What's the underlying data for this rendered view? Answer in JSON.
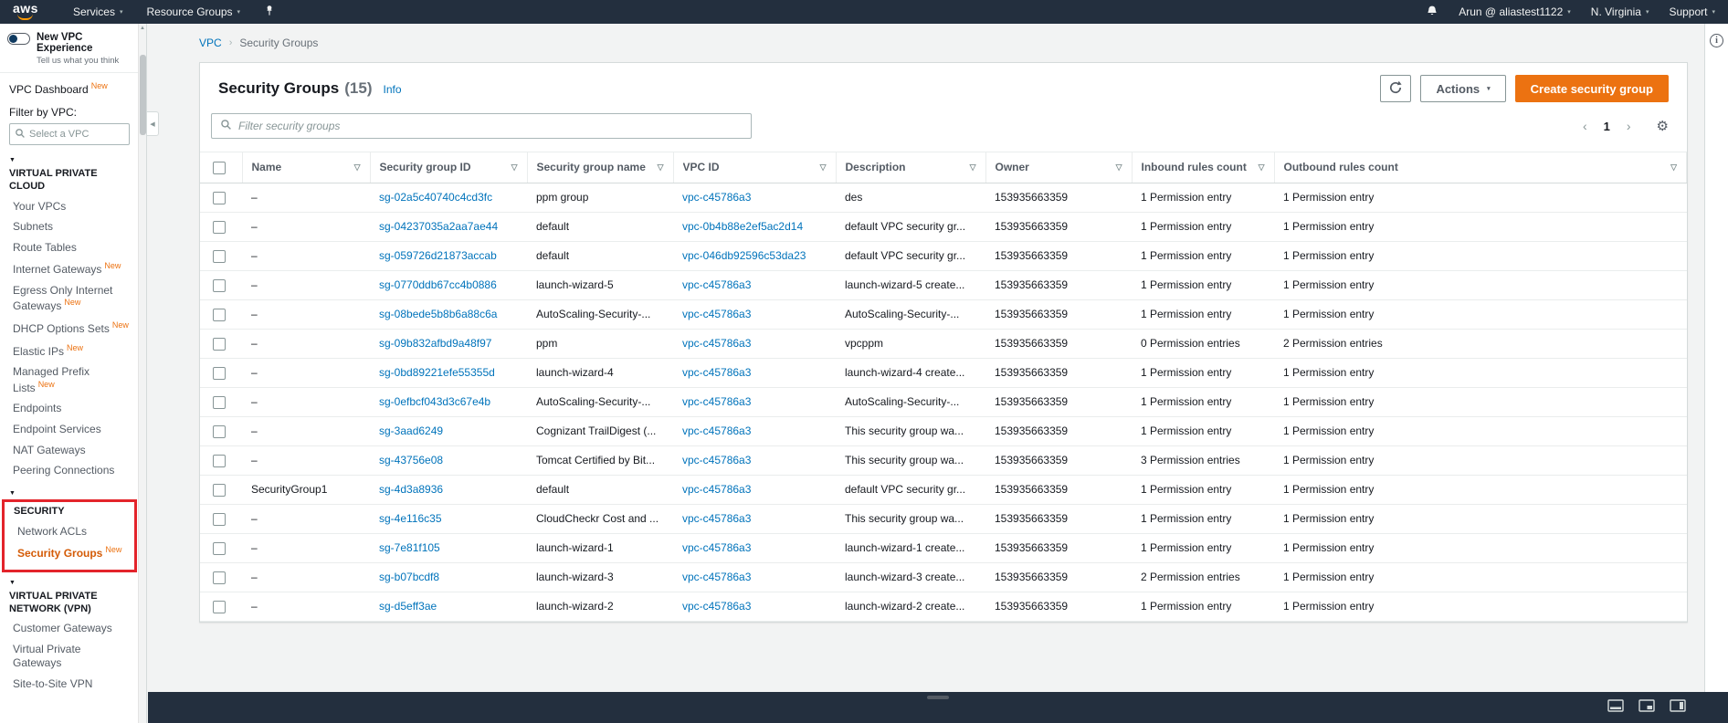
{
  "colors": {
    "topnav_bg": "#232f3e",
    "accent_orange": "#ec7211",
    "link_blue": "#0073bb",
    "highlight_red": "#e3242b",
    "selected_nav": "#d45b07"
  },
  "icons": {
    "caret_down": "▾",
    "section_triangle": "▼",
    "column_filter": "▽",
    "chevron_left": "‹",
    "chevron_right": "›",
    "gear": "⚙",
    "collapse_left": "◀",
    "info": "i"
  },
  "topnav": {
    "logo_text": "aws",
    "services_label": "Services",
    "resource_groups_label": "Resource Groups",
    "user_label": "Arun @ aliastest1122",
    "region_label": "N. Virginia",
    "support_label": "Support"
  },
  "sidebar": {
    "experience": {
      "title": "New VPC Experience",
      "subtitle": "Tell us what you think"
    },
    "dashboard": {
      "label": "VPC Dashboard",
      "badge": "New"
    },
    "filter_label": "Filter by VPC:",
    "filter_placeholder": "Select a VPC",
    "sections": [
      {
        "title": "VIRTUAL PRIVATE CLOUD",
        "items": [
          {
            "label": "Your VPCs"
          },
          {
            "label": "Subnets"
          },
          {
            "label": "Route Tables"
          },
          {
            "label": "Internet Gateways",
            "badge": "New"
          },
          {
            "label": "Egress Only Internet Gateways",
            "badge": "New"
          },
          {
            "label": "DHCP Options Sets",
            "badge": "New"
          },
          {
            "label": "Elastic IPs",
            "badge": "New"
          },
          {
            "label": "Managed Prefix Lists",
            "badge": "New"
          },
          {
            "label": "Endpoints"
          },
          {
            "label": "Endpoint Services"
          },
          {
            "label": "NAT Gateways"
          },
          {
            "label": "Peering Connections"
          }
        ]
      },
      {
        "title": "SECURITY",
        "items": [
          {
            "label": "Network ACLs"
          },
          {
            "label": "Security Groups",
            "badge": "New",
            "selected": true
          }
        ]
      },
      {
        "title": "VIRTUAL PRIVATE NETWORK (VPN)",
        "items": [
          {
            "label": "Customer Gateways"
          },
          {
            "label": "Virtual Private Gateways"
          },
          {
            "label": "Site-to-Site VPN"
          }
        ]
      }
    ]
  },
  "breadcrumb": {
    "items": [
      "VPC",
      "Security Groups"
    ],
    "separator": "›"
  },
  "header": {
    "title": "Security Groups",
    "count": "(15)",
    "info_label": "Info",
    "actions_label": "Actions",
    "create_label": "Create security group"
  },
  "toolbar": {
    "filter_placeholder": "Filter security groups",
    "page_number": "1"
  },
  "table": {
    "columns": [
      "Name",
      "Security group ID",
      "Security group name",
      "VPC ID",
      "Description",
      "Owner",
      "Inbound rules count",
      "Outbound rules count"
    ],
    "rows": [
      {
        "name": "–",
        "id": "sg-02a5c40740c4cd3fc",
        "group_name": "ppm group",
        "vpc_id": "vpc-c45786a3",
        "description": "des",
        "owner": "153935663359",
        "inbound": "1 Permission entry",
        "outbound": "1 Permission entry"
      },
      {
        "name": "–",
        "id": "sg-04237035a2aa7ae44",
        "group_name": "default",
        "vpc_id": "vpc-0b4b88e2ef5ac2d14",
        "description": "default VPC security gr...",
        "owner": "153935663359",
        "inbound": "1 Permission entry",
        "outbound": "1 Permission entry"
      },
      {
        "name": "–",
        "id": "sg-059726d21873accab",
        "group_name": "default",
        "vpc_id": "vpc-046db92596c53da23",
        "description": "default VPC security gr...",
        "owner": "153935663359",
        "inbound": "1 Permission entry",
        "outbound": "1 Permission entry"
      },
      {
        "name": "–",
        "id": "sg-0770ddb67cc4b0886",
        "group_name": "launch-wizard-5",
        "vpc_id": "vpc-c45786a3",
        "description": "launch-wizard-5 create...",
        "owner": "153935663359",
        "inbound": "1 Permission entry",
        "outbound": "1 Permission entry"
      },
      {
        "name": "–",
        "id": "sg-08bede5b8b6a88c6a",
        "group_name": "AutoScaling-Security-...",
        "vpc_id": "vpc-c45786a3",
        "description": "AutoScaling-Security-...",
        "owner": "153935663359",
        "inbound": "1 Permission entry",
        "outbound": "1 Permission entry"
      },
      {
        "name": "–",
        "id": "sg-09b832afbd9a48f97",
        "group_name": "ppm",
        "vpc_id": "vpc-c45786a3",
        "description": "vpcppm",
        "owner": "153935663359",
        "inbound": "0 Permission entries",
        "outbound": "2 Permission entries"
      },
      {
        "name": "–",
        "id": "sg-0bd89221efe55355d",
        "group_name": "launch-wizard-4",
        "vpc_id": "vpc-c45786a3",
        "description": "launch-wizard-4 create...",
        "owner": "153935663359",
        "inbound": "1 Permission entry",
        "outbound": "1 Permission entry"
      },
      {
        "name": "–",
        "id": "sg-0efbcf043d3c67e4b",
        "group_name": "AutoScaling-Security-...",
        "vpc_id": "vpc-c45786a3",
        "description": "AutoScaling-Security-...",
        "owner": "153935663359",
        "inbound": "1 Permission entry",
        "outbound": "1 Permission entry"
      },
      {
        "name": "–",
        "id": "sg-3aad6249",
        "group_name": "Cognizant TrailDigest (...",
        "vpc_id": "vpc-c45786a3",
        "description": "This security group wa...",
        "owner": "153935663359",
        "inbound": "1 Permission entry",
        "outbound": "1 Permission entry"
      },
      {
        "name": "–",
        "id": "sg-43756e08",
        "group_name": "Tomcat Certified by Bit...",
        "vpc_id": "vpc-c45786a3",
        "description": "This security group wa...",
        "owner": "153935663359",
        "inbound": "3 Permission entries",
        "outbound": "1 Permission entry"
      },
      {
        "name": "SecurityGroup1",
        "id": "sg-4d3a8936",
        "group_name": "default",
        "vpc_id": "vpc-c45786a3",
        "description": "default VPC security gr...",
        "owner": "153935663359",
        "inbound": "1 Permission entry",
        "outbound": "1 Permission entry"
      },
      {
        "name": "–",
        "id": "sg-4e116c35",
        "group_name": "CloudCheckr Cost and ...",
        "vpc_id": "vpc-c45786a3",
        "description": "This security group wa...",
        "owner": "153935663359",
        "inbound": "1 Permission entry",
        "outbound": "1 Permission entry"
      },
      {
        "name": "–",
        "id": "sg-7e81f105",
        "group_name": "launch-wizard-1",
        "vpc_id": "vpc-c45786a3",
        "description": "launch-wizard-1 create...",
        "owner": "153935663359",
        "inbound": "1 Permission entry",
        "outbound": "1 Permission entry"
      },
      {
        "name": "–",
        "id": "sg-b07bcdf8",
        "group_name": "launch-wizard-3",
        "vpc_id": "vpc-c45786a3",
        "description": "launch-wizard-3 create...",
        "owner": "153935663359",
        "inbound": "2 Permission entries",
        "outbound": "1 Permission entry"
      },
      {
        "name": "–",
        "id": "sg-d5eff3ae",
        "group_name": "launch-wizard-2",
        "vpc_id": "vpc-c45786a3",
        "description": "launch-wizard-2 create...",
        "owner": "153935663359",
        "inbound": "1 Permission entry",
        "outbound": "1 Permission entry"
      }
    ]
  }
}
